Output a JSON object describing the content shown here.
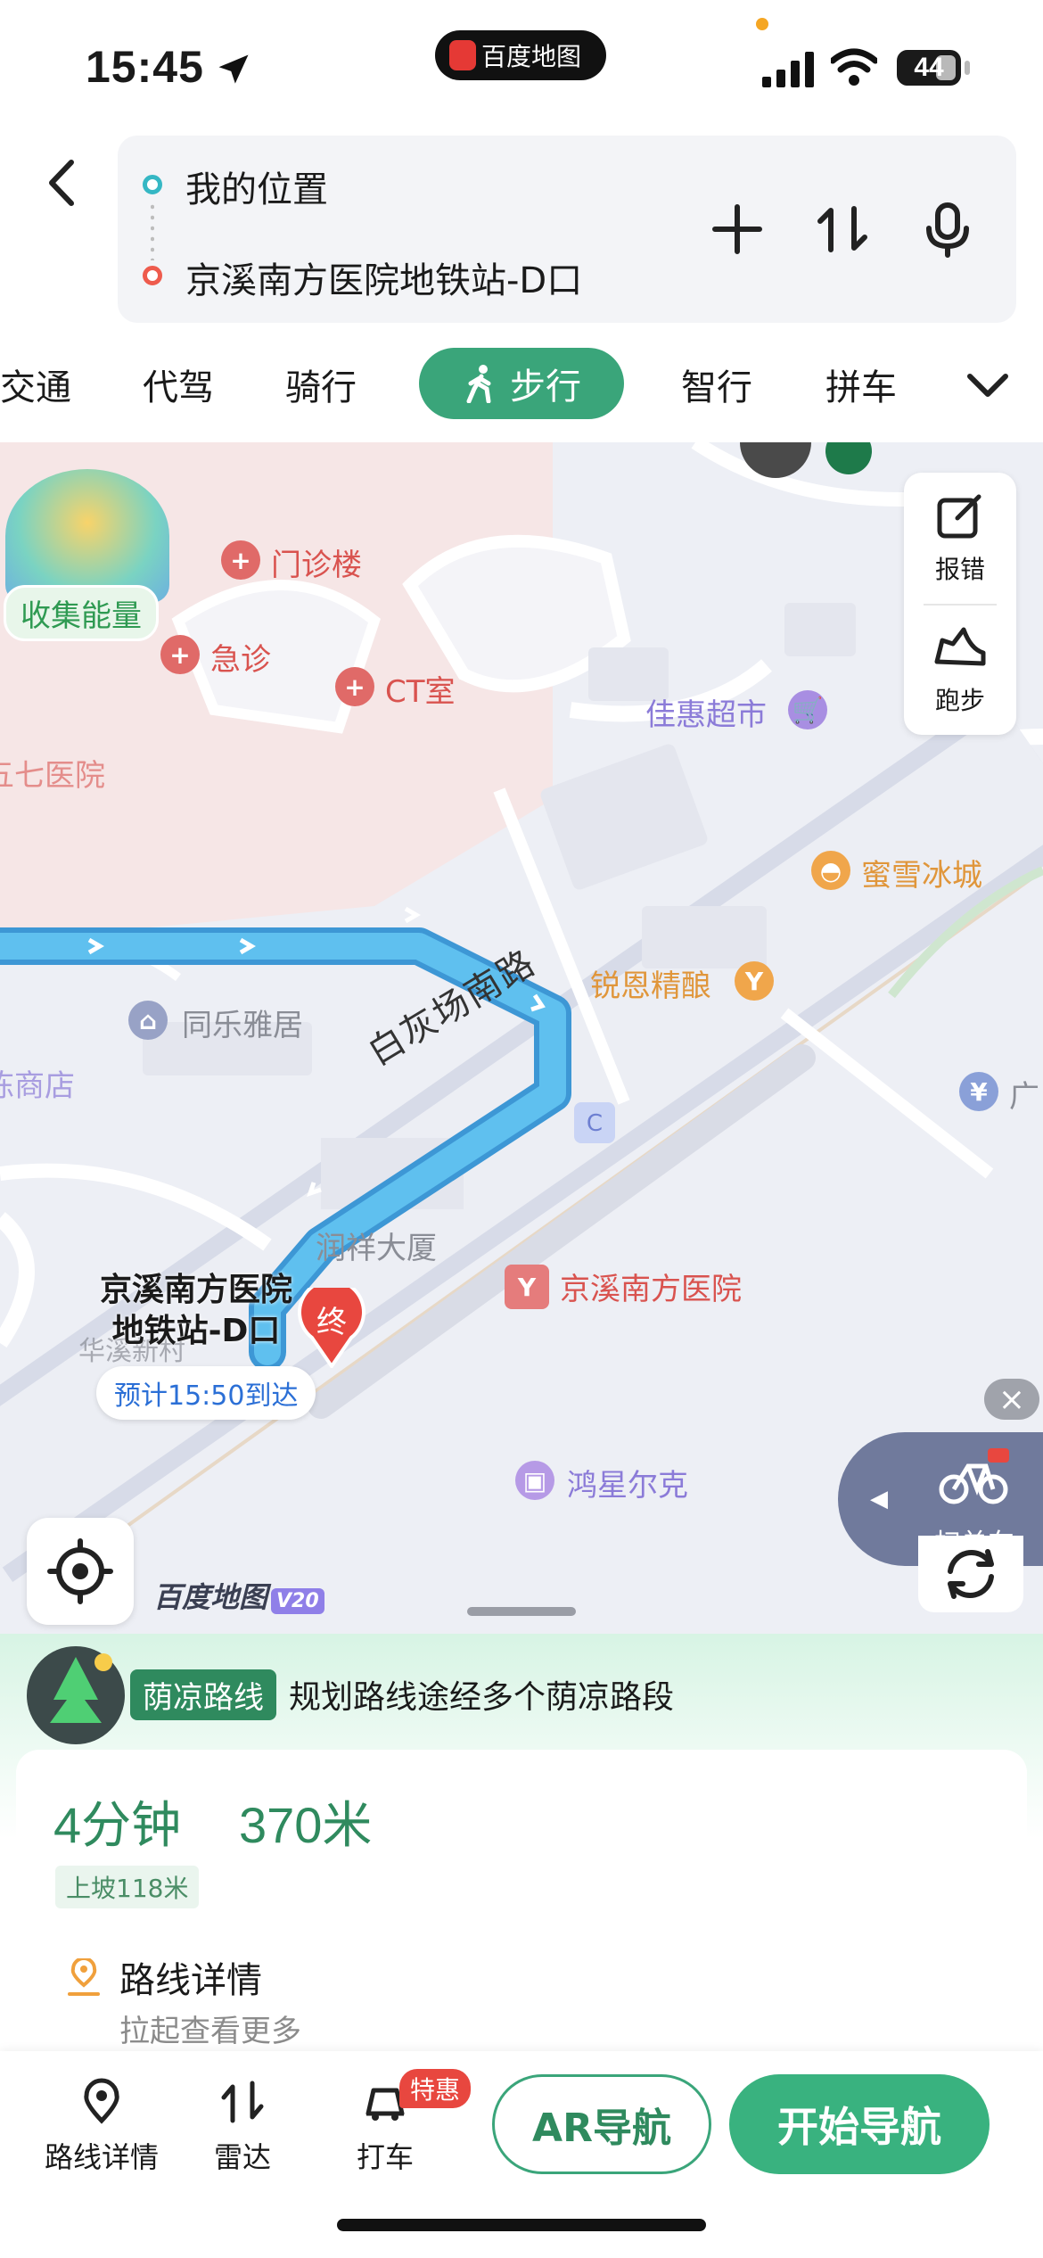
{
  "status_bar": {
    "time": "15:45",
    "island_app": "百度地图",
    "battery": "44"
  },
  "route": {
    "start": "我的位置",
    "end": "京溪南方医院地铁站-D口"
  },
  "modes": {
    "items": [
      "交通",
      "代驾",
      "骑行",
      "步行",
      "智行",
      "拼车"
    ],
    "active": "步行"
  },
  "map": {
    "energy_label": "收集能量",
    "tools": [
      "报错",
      "跑步"
    ],
    "pois": {
      "outpatient": "门诊楼",
      "emergency": "急诊",
      "ct": "CT室",
      "hospital157": "五七医院",
      "jiahui": "佳惠超市",
      "mixue": "蜜雪冰城",
      "ruien": "锐恩精酿",
      "tongle": "同乐雅居",
      "shop": "栋商店",
      "runxiang": "润祥大厦",
      "station": "京溪南方医院",
      "huaxi": "华溪新村",
      "hongxing": "鸿星尔克",
      "guang": "广"
    },
    "street": "白灰场南路",
    "destination_line1": "京溪南方医院",
    "destination_line2": "地铁站-D口",
    "end_marker": "终",
    "eta": "预计15:50到达",
    "scan_bike": "扫单车",
    "brand": "百度地图",
    "brand_version": "V20"
  },
  "panel": {
    "shade_tag": "荫凉路线",
    "shade_text": "规划路线途经多个荫凉路段",
    "duration": "4分钟",
    "distance": "370米",
    "slope": "上坡118米",
    "detail_title": "路线详情",
    "detail_sub": "拉起查看更多"
  },
  "bottom_bar": {
    "route_detail": "路线详情",
    "radar": "雷达",
    "taxi": "打车",
    "taxi_badge": "特惠",
    "ar_nav": "AR导航",
    "start_nav": "开始导航"
  },
  "colors": {
    "accent_green": "#3aa57a",
    "route_blue": "#4fb3e8",
    "end_red": "#e8473f"
  }
}
